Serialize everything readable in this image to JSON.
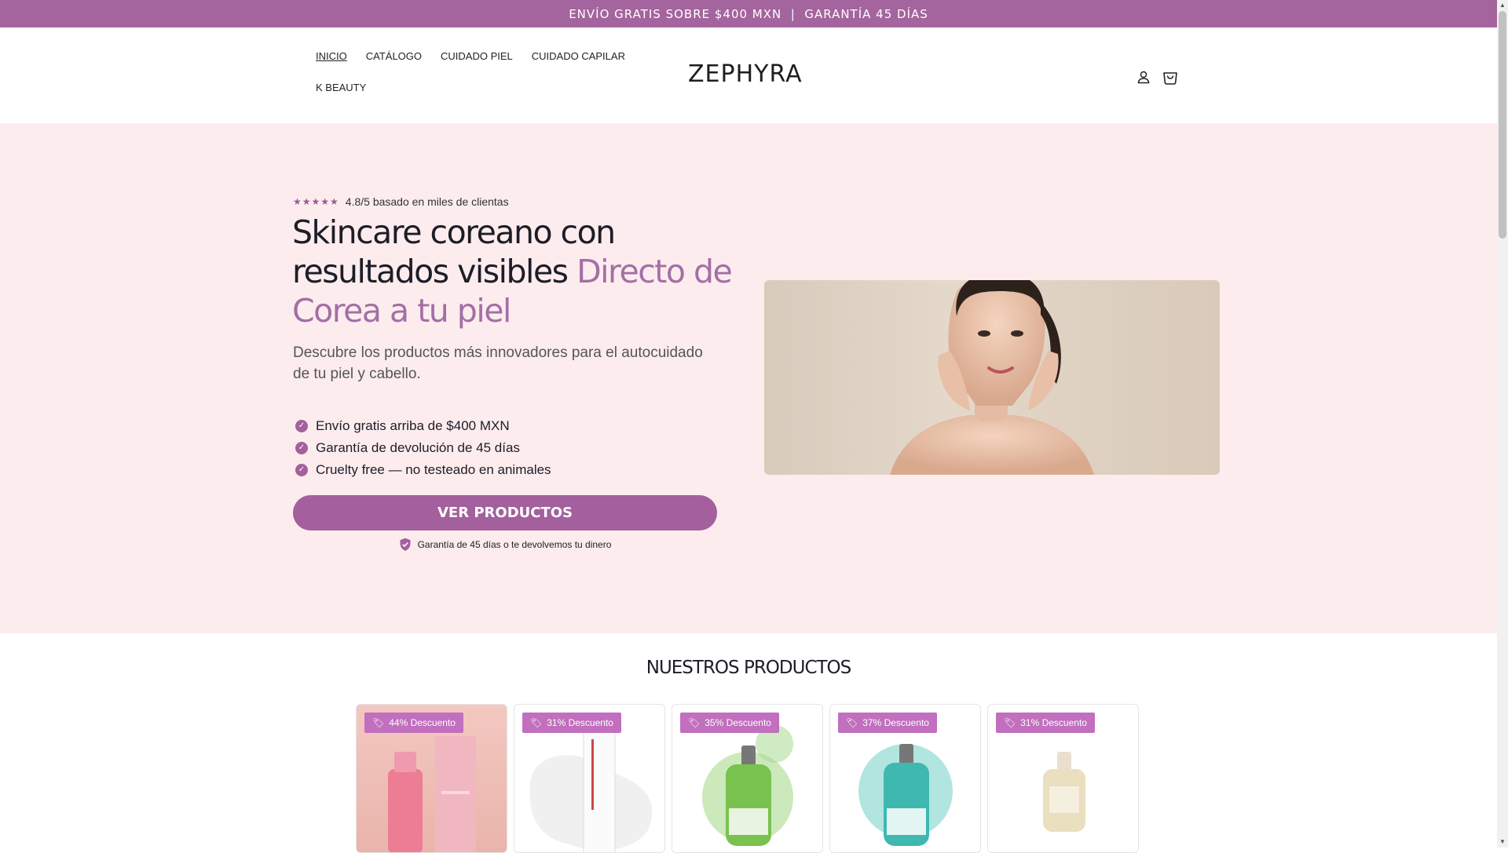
{
  "announcement": "ENVÍO GRATIS SOBRE $400 MXN  |  GARANTÍA 45 DÍAS",
  "nav": {
    "items": [
      {
        "label": "INICIO",
        "active": true
      },
      {
        "label": "CATÁLOGO"
      },
      {
        "label": "CUIDADO PIEL"
      },
      {
        "label": "CUIDADO CAPILAR"
      },
      {
        "label": "K BEAUTY"
      }
    ]
  },
  "brand": {
    "logo": "ZEPHYRA"
  },
  "header_icons": [
    "account-icon",
    "cart-icon"
  ],
  "hero": {
    "rating_stars": "★★★★★",
    "rating_text": "4.8/5 basado en miles de clientas",
    "headline_main": "Skincare coreano con resultados visibles",
    "headline_accent": "Directo de Corea a tu piel",
    "subcopy": "Descubre los productos más innovadores para el autocuidado de tu piel y cabello.",
    "benefits": [
      "Envío gratis arriba de $400 MXN",
      "Garantía de devolución de 45 días",
      "Cruelty free — no testeado en animales"
    ],
    "cta_label": "VER PRODUCTOS",
    "guarantee_text": "Garantía de 45 días o te devolvemos tu dinero"
  },
  "products": {
    "title": "NUESTROS PRODUCTOS",
    "items": [
      {
        "badge": "44% Descuento"
      },
      {
        "badge": "31% Descuento"
      },
      {
        "badge": "35% Descuento"
      },
      {
        "badge": "37% Descuento"
      },
      {
        "badge": "31% Descuento"
      }
    ]
  },
  "colors": {
    "brand_purple": "#a4649d",
    "hero_background": "#fcecee",
    "accent_text": "#a36fa5",
    "badge": "#c16fbe"
  }
}
